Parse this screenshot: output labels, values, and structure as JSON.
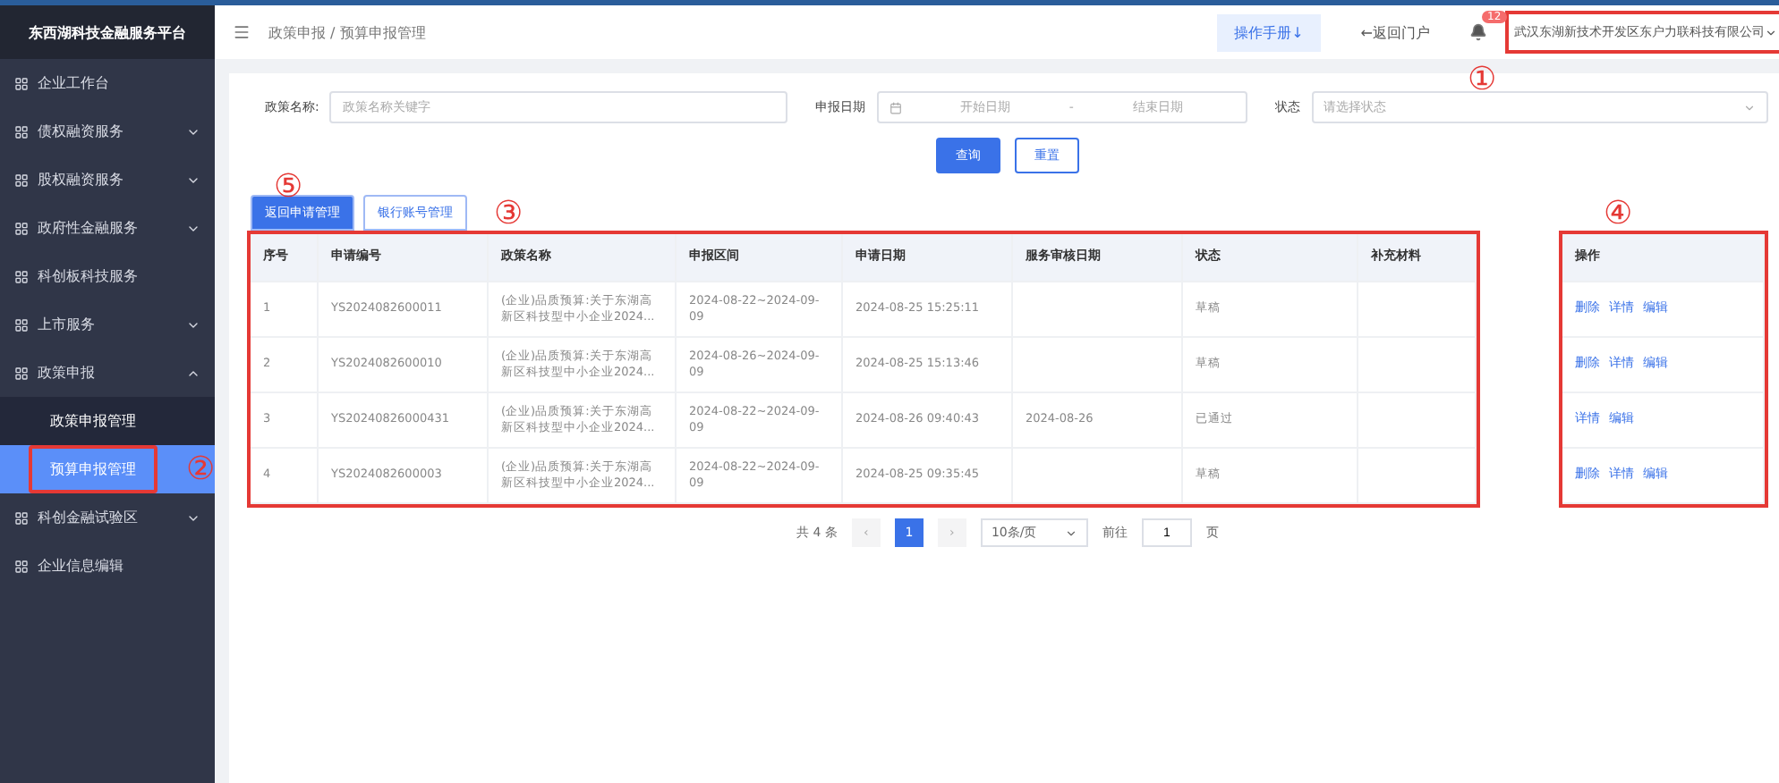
{
  "sidebar": {
    "title": "东西湖科技金融服务平台",
    "items": [
      {
        "label": "企业工作台",
        "expandable": false,
        "selected": false
      },
      {
        "label": "债权融资服务",
        "expandable": true,
        "expanded": false,
        "selected": false
      },
      {
        "label": "股权融资服务",
        "expandable": true,
        "expanded": false,
        "selected": false
      },
      {
        "label": "政府性金融服务",
        "expandable": true,
        "expanded": false,
        "selected": false
      },
      {
        "label": "科创板科技服务",
        "expandable": false,
        "selected": false
      },
      {
        "label": "上市服务",
        "expandable": true,
        "expanded": false,
        "selected": false
      },
      {
        "label": "政策申报",
        "expandable": true,
        "expanded": true,
        "selected": false,
        "children": [
          {
            "label": "政策申报管理",
            "selected": false
          },
          {
            "label": "预算申报管理",
            "selected": true
          }
        ]
      },
      {
        "label": "科创金融试验区",
        "expandable": true,
        "expanded": false,
        "selected": false
      },
      {
        "label": "企业信息编辑",
        "expandable": false,
        "selected": false
      }
    ]
  },
  "header": {
    "breadcrumb": [
      "政策申报",
      "预算申报管理"
    ],
    "breadcrumb_separator": "/",
    "manual_button": "操作手册↓",
    "portal_link": "←返回门户",
    "notification_count": "12",
    "user": "武汉东湖新技术开发区东户力联科技有限公司"
  },
  "filters": {
    "policy_label": "政策名称:",
    "policy_placeholder": "政策名称关键字",
    "date_label": "申报日期",
    "start_placeholder": "开始日期",
    "separator": "-",
    "end_placeholder": "结束日期",
    "status_label": "状态",
    "status_placeholder": "请选择状态",
    "buttons": [
      "查询",
      "重置"
    ]
  },
  "tabs": [
    {
      "label": "返回申请管理",
      "selected": true
    },
    {
      "label": "银行账号管理",
      "selected": false
    }
  ],
  "table": {
    "columns": [
      "序号",
      "申请编号",
      "政策名称",
      "申报区间",
      "申请日期",
      "服务审核日期",
      "状态",
      "补充材料"
    ],
    "action_column": "操作",
    "rows": [
      {
        "cells": [
          "1",
          "YS2024082600011",
          "(企业)品质预算:关于东湖高新区科技型中小企业2024...",
          "2024-08-22~2024-09-09",
          "2024-08-25 15:25:11",
          "",
          "草稿",
          ""
        ],
        "actions": [
          "删除",
          "详情",
          "编辑"
        ]
      },
      {
        "cells": [
          "2",
          "YS2024082600010",
          "(企业)品质预算:关于东湖高新区科技型中小企业2024...",
          "2024-08-26~2024-09-09",
          "2024-08-25 15:13:46",
          "",
          "草稿",
          ""
        ],
        "actions": [
          "删除",
          "详情",
          "编辑"
        ]
      },
      {
        "cells": [
          "3",
          "YS20240826000431",
          "(企业)品质预算:关于东湖高新区科技型中小企业2024...",
          "2024-08-22~2024-09-09",
          "2024-08-26 09:40:43",
          "2024-08-26",
          "已通过",
          ""
        ],
        "actions": [
          "详情",
          "编辑"
        ]
      },
      {
        "cells": [
          "4",
          "YS2024082600003",
          "(企业)品质预算:关于东湖高新区科技型中小企业2024...",
          "2024-08-22~2024-09-09",
          "2024-08-25 09:35:45",
          "",
          "草稿",
          ""
        ],
        "actions": [
          "删除",
          "详情",
          "编辑"
        ]
      }
    ]
  },
  "pagination": {
    "total": "共 4 条",
    "prev": "‹",
    "pages": [
      {
        "label": "1",
        "selected": true
      }
    ],
    "next": "›",
    "page_size": "10条/页",
    "goto_label": "前往",
    "goto_value": "1",
    "goto_suffix": "页"
  },
  "annotations": {
    "user": "①",
    "menu": "②",
    "table": "③",
    "actions": "④",
    "tabs": "⑤"
  }
}
